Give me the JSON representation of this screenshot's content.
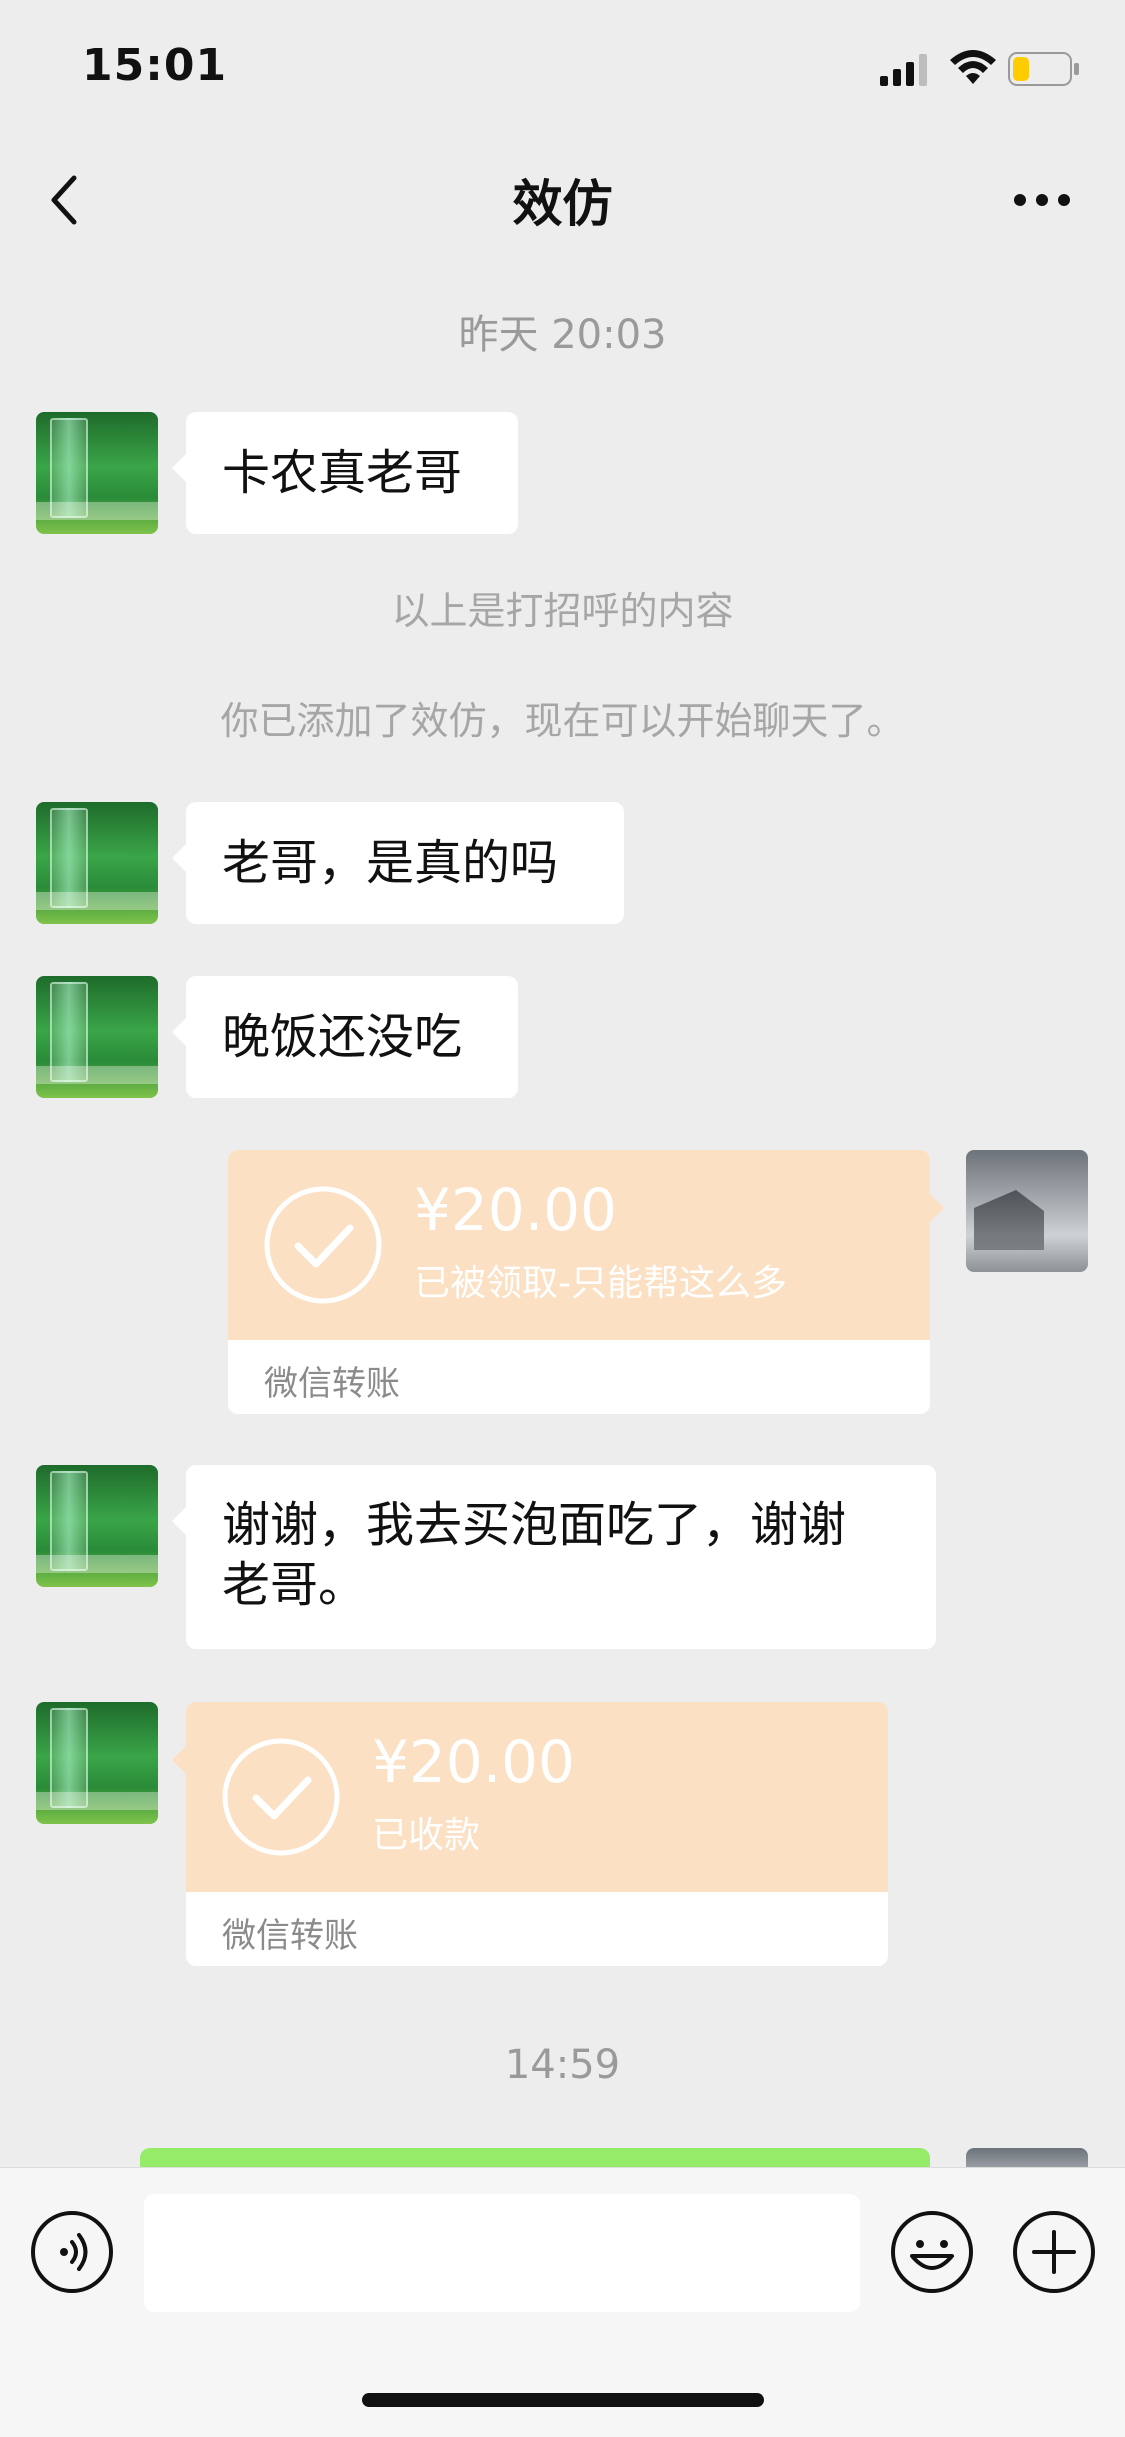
{
  "status_bar": {
    "time": "15:01",
    "battery_level": 0.3,
    "battery_color": "#ffcc00"
  },
  "header": {
    "title": "效仿"
  },
  "chat": {
    "timestamp_1": "昨天 20:03",
    "msg_1": "卡农真老哥",
    "system_1": "以上是打招呼的内容",
    "system_2": "你已添加了效仿，现在可以开始聊天了。",
    "msg_2": "老哥，是真的吗",
    "msg_3": "晚饭还没吃",
    "transfer_sent": {
      "amount": "¥20.00",
      "note": "已被领取-只能帮这么多",
      "label": "微信转账"
    },
    "msg_4_line1": "谢谢，我去买泡面吃了，谢谢",
    "msg_4_line2": "老哥。",
    "transfer_received": {
      "amount": "¥20.00",
      "note": "已收款",
      "label": "微信转账"
    },
    "timestamp_2": "14:59"
  },
  "colors": {
    "background": "#ededed",
    "transfer": "#fbe0c4",
    "sent_bubble": "#95ec69"
  },
  "icons": [
    "back-icon",
    "more-icon",
    "voice-icon",
    "emoji-icon",
    "plus-icon",
    "check-circle-icon"
  ]
}
